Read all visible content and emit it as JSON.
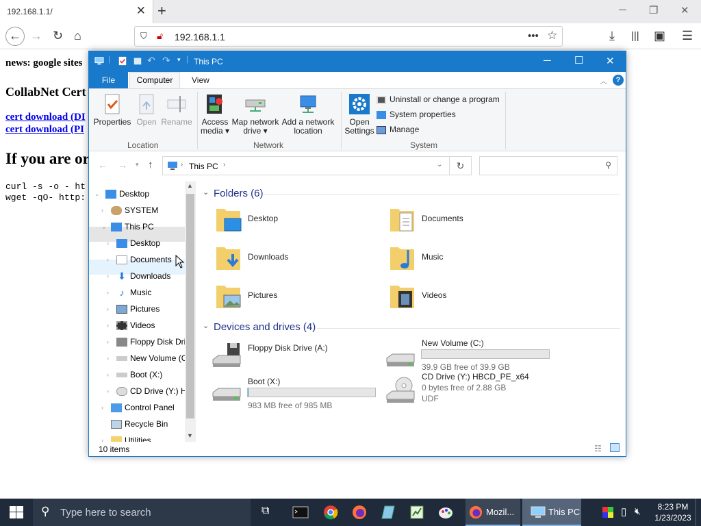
{
  "browser": {
    "tab_title": "192.168.1.1/",
    "url": "192.168.1.1"
  },
  "webpage": {
    "line1": "news: google sites",
    "line2": "CollabNet Cert",
    "link1": "cert download (DI",
    "link2": "cert download (PI",
    "heading": "If you are or",
    "code1": "curl -s -o - ht",
    "code2": "wget -qO- http:"
  },
  "explorer": {
    "title": "This PC",
    "tabs": {
      "file": "File",
      "computer": "Computer",
      "view": "View"
    },
    "ribbon": {
      "properties": "Properties",
      "open": "Open",
      "rename": "Rename",
      "access_media": "Access media",
      "map_drive": "Map network drive",
      "add_location": "Add a network location",
      "open_settings": "Open Settings",
      "uninstall": "Uninstall or change a program",
      "system_props": "System properties",
      "manage": "Manage",
      "group_location": "Location",
      "group_network": "Network",
      "group_system": "System"
    },
    "address": "This PC",
    "nav": [
      {
        "label": "Desktop"
      },
      {
        "label": "SYSTEM"
      },
      {
        "label": "This PC"
      },
      {
        "label": "Desktop"
      },
      {
        "label": "Documents"
      },
      {
        "label": "Downloads"
      },
      {
        "label": "Music"
      },
      {
        "label": "Pictures"
      },
      {
        "label": "Videos"
      },
      {
        "label": "Floppy Disk Dri"
      },
      {
        "label": "New Volume (C"
      },
      {
        "label": "Boot (X:)"
      },
      {
        "label": "CD Drive (Y:) H"
      },
      {
        "label": "Control Panel"
      },
      {
        "label": "Recycle Bin"
      },
      {
        "label": "Utilities"
      }
    ],
    "folders_header": "Folders (6)",
    "folders": [
      {
        "name": "Desktop"
      },
      {
        "name": "Documents"
      },
      {
        "name": "Downloads"
      },
      {
        "name": "Music"
      },
      {
        "name": "Pictures"
      },
      {
        "name": "Videos"
      }
    ],
    "devices_header": "Devices and drives (4)",
    "drives": [
      {
        "name": "Floppy Disk Drive (A:)",
        "free": ""
      },
      {
        "name": "New Volume (C:)",
        "free": "39.9 GB free of 39.9 GB",
        "used_fraction": 0.0
      },
      {
        "name": "Boot (X:)",
        "free": "983 MB free of 985 MB",
        "used_fraction": 0.002
      },
      {
        "name": "CD Drive (Y:) HBCD_PE_x64",
        "free": "0 bytes free of 2.88 GB",
        "fs": "UDF"
      }
    ],
    "status": "10 items"
  },
  "taskbar": {
    "search_placeholder": "Type here to search",
    "firefox_label": "Mozil...",
    "explorer_label": "This PC",
    "time": "8:23 PM",
    "date": "1/23/2023"
  },
  "colors": {
    "accent": "#1979ca",
    "section_header": "#1e3287",
    "taskbar": "#1f2b3a",
    "link": "#0000ee"
  }
}
